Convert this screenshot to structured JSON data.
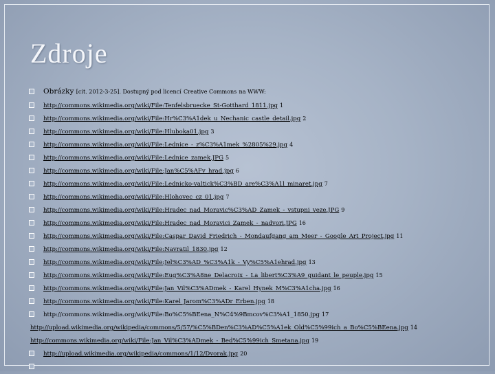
{
  "title": "Zdroje",
  "heading": {
    "label": "Obrázky",
    "citation": "[cit. 2012-3-25]. Dostupný pod licencí",
    "license": "Creative Commons",
    "tail": "na WWW:"
  },
  "sources": [
    {
      "url": "http://commons.wikimedia.org/wiki/File:Tenfelsbruecke_St-Gotthard_1811.jpg",
      "num": "1",
      "link": true,
      "bullet": true,
      "indent": true
    },
    {
      "url": "http://commons.wikimedia.org/wiki/File:Hr%C3%A1dek_u_Nechanic_castle_detail.jpg",
      "num": "2",
      "link": true,
      "bullet": true,
      "indent": true
    },
    {
      "url": "http://commons.wikimedia.org/wiki/File:Hluboka01.jpg",
      "num": "3",
      "link": true,
      "bullet": true,
      "indent": true
    },
    {
      "url": "http://commons.wikimedia.org/wiki/File:Lednice_-_z%C3%A1mek_%2805%29.jpg",
      "num": "4",
      "link": true,
      "bullet": true,
      "indent": true
    },
    {
      "url": "http://commons.wikimedia.org/wiki/File:Lednice_zamek.JPG",
      "num": "5",
      "link": true,
      "bullet": true,
      "indent": true
    },
    {
      "url": "http://commons.wikimedia.org/wiki/File:Jan%C5%AFv_hrad.jpg",
      "num": "6",
      "link": true,
      "bullet": true,
      "indent": true
    },
    {
      "url": "http://commons.wikimedia.org/wiki/File:Lednicko-valtick%C3%BD_are%C3%A1l_minaret.jpg",
      "num": "7",
      "link": true,
      "bullet": true,
      "indent": true
    },
    {
      "url": "http://commons.wikimedia.org/wiki/File:Hlohovec_cz_01.jpg",
      "num": "7",
      "link": true,
      "bullet": true,
      "indent": true
    },
    {
      "url": "http://commons.wikimedia.org/wiki/File:Hradec_nad_Moravic%C3%AD_Zamek_-_vstupni_veze.JPG",
      "num": "9",
      "link": true,
      "bullet": true,
      "indent": true
    },
    {
      "url": "http://commons.wikimedia.org/wiki/File:Hradec_nad_Moravici_Zamek_-_nadvori.JPG",
      "num": "16",
      "link": true,
      "bullet": true,
      "indent": true
    },
    {
      "url": "http://commons.wikimedia.org/wiki/File:Caspar_David_Friedrich_-_Mondaufgang_am_Meer_-_Google_Art_Project.jpg",
      "num": "11",
      "link": true,
      "bullet": true,
      "indent": true
    },
    {
      "url": "http://commons.wikimedia.org/wiki/File:Navratil_1830.jpg",
      "num": "12",
      "link": true,
      "bullet": true,
      "indent": true
    },
    {
      "url": "http://commons.wikimedia.org/wiki/File:Jel%C3%AD_%C3%A1k_-_Vy%C5%A1ehrad.jpg",
      "num": "13",
      "link": true,
      "bullet": true,
      "indent": true
    },
    {
      "url": "http://commons.wikimedia.org/wiki/File:Eug%C3%A8ne_Delacroix_-_La_libert%C3%A9_guidant_le_peuple.jpg",
      "num": "15",
      "link": true,
      "bullet": true,
      "indent": true
    },
    {
      "url": "http://commons.wikimedia.org/wiki/File:Jan_Vil%C3%ADmek_-_Karel_Hynek_M%C3%A1cha.jpg",
      "num": "16",
      "link": true,
      "bullet": true,
      "indent": true
    },
    {
      "url": "http://commons.wikimedia.org/wiki/File:Karel_Jarom%C3%ADr_Erben.jpg",
      "num": "18",
      "link": true,
      "bullet": true,
      "indent": true
    },
    {
      "url": "http://commons.wikimedia.org/wiki/File:Bo%C5%BEena_N%C4%9Bmcov%C3%A1_1850.jpg",
      "num": "17",
      "link": false,
      "bullet": true,
      "indent": true
    },
    {
      "url": "http://upload.wikimedia.org/wikipedia/commons/5/57/%C5%BDen%C3%AD%C5%A1ek_Old%C5%99ich_a_Bo%C5%BEena.jpg",
      "num": "14",
      "link": true,
      "bullet": false,
      "indent": false
    },
    {
      "url": "http://commons.wikimedia.org/wiki/File:Jan_Vil%C3%ADmek_-_Bed%C5%99ich_Smetana.jpg",
      "num": "19",
      "link": true,
      "bullet": false,
      "indent": false
    },
    {
      "url": "http://upload.wikimedia.org/wikipedia/commons/1/12/Dvorak.jpg",
      "num": "20",
      "link": true,
      "bullet": true,
      "indent": true
    },
    {
      "url": "",
      "num": "",
      "link": false,
      "bullet": true,
      "indent": true
    }
  ]
}
